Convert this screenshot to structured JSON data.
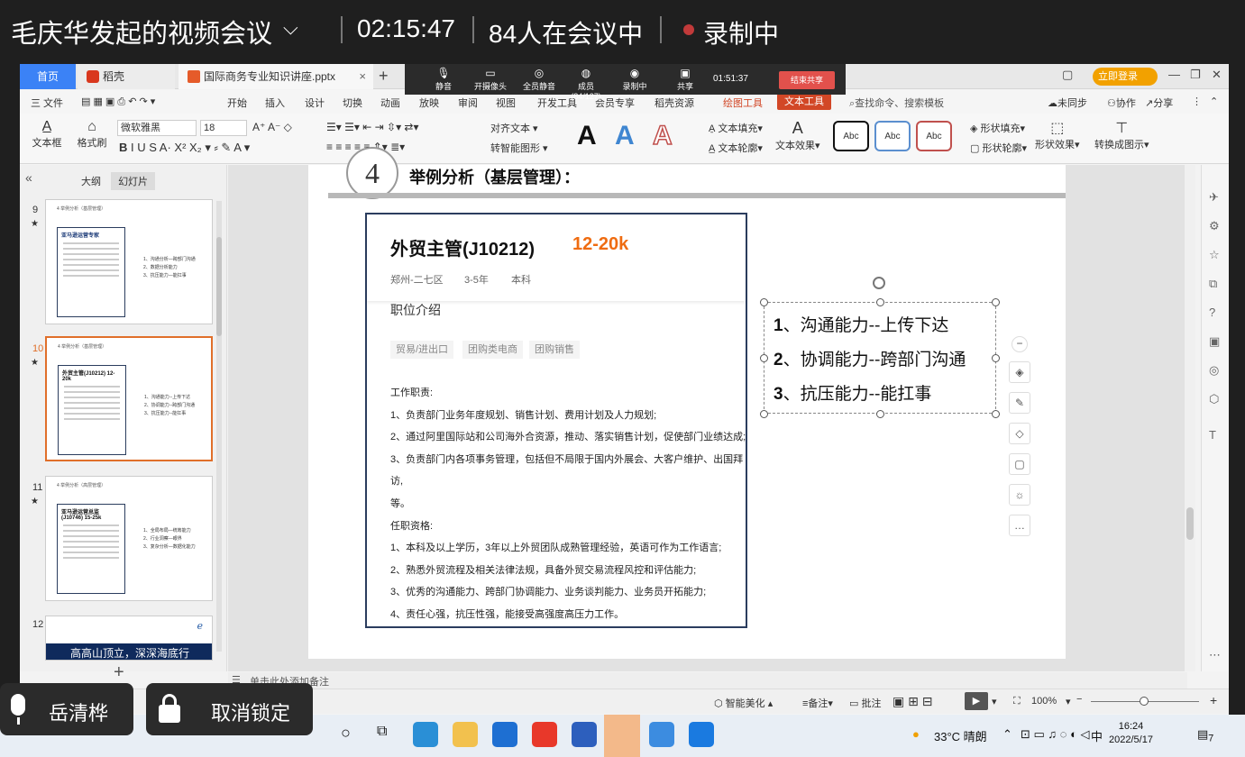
{
  "meeting": {
    "title": "毛庆华发起的视频会议",
    "timer": "02:15:47",
    "participants": "84人在会议中",
    "recording": "录制中"
  },
  "wps": {
    "tabs": {
      "home": "首页",
      "daoke": "稻壳",
      "file": "国际商务专业知识讲座.pptx",
      "close": "×",
      "plus": "+"
    },
    "login": "立即登录",
    "share_bar": {
      "items": [
        "静音",
        "开摄像头",
        "全员静音",
        "成员(84/127)",
        "录制中",
        "共享"
      ],
      "time": "01:51:37",
      "end": "结束共享"
    },
    "menu": {
      "file": "三 文件",
      "items": [
        "开始",
        "插入",
        "设计",
        "切换",
        "动画",
        "放映",
        "审阅",
        "视图",
        "开发工具",
        "会员专享",
        "稻壳资源"
      ],
      "draw_tool": "绘图工具",
      "text_tool": "文本工具",
      "search": "查找命令、搜索模板",
      "sync": "未同步",
      "collab": "协作",
      "share": "分享"
    },
    "ribbon": {
      "textbox": "文本框",
      "format_brush": "格式刷",
      "font": "微软雅黑",
      "size": "18",
      "align_text": "对齐文本",
      "smart_shape": "转智能图形",
      "text_fill": "文本填充",
      "text_outline": "文本轮廓",
      "text_effect": "文本效果",
      "abc": "Abc",
      "shape_fill": "形状填充",
      "shape_outline": "形状轮廓",
      "shape_effect": "形状效果",
      "convert": "转换成图示"
    },
    "panel": {
      "outline": "大纲",
      "slides": "幻灯片",
      "slide_nums": [
        "9",
        "10",
        "11",
        "12"
      ],
      "star": "★",
      "add": "+",
      "thumb12_text": "高高山顶立，深深海底行",
      "thumb9": {
        "header": "4 举例分析（基层管理）",
        "title": "亚马逊运营专家",
        "side": [
          "1、沟通分析—跨部门沟通",
          "2、数据分析能力",
          "3、抗压能力—能扛事"
        ]
      },
      "thumb10": {
        "header": "4 举例分析（基层管理）",
        "title": "外贸主管(J10212)  12-20k",
        "side": [
          "1、沟通能力--上传下达",
          "2、协调能力--跨部门沟通",
          "3、抗压能力--能扛事"
        ]
      },
      "thumb11": {
        "header": "4 举例分析（高层管理）",
        "title": "亚马逊运营总监(J10746)  15-25k",
        "side": [
          "1、全局布局—统筹能力",
          "2、行业洞察—眼界",
          "3、复杂分析—数据化能力"
        ]
      }
    },
    "slide": {
      "num": "4",
      "heading": "举例分析（基层管理）：",
      "job_title": "外贸主管(J10212)",
      "salary": "12-20k",
      "meta": [
        "郑州-二七区",
        "3-5年",
        "本科"
      ],
      "intro": "职位介绍",
      "tags": [
        "贸易/进出口",
        "团购类电商",
        "团购销售"
      ],
      "body": [
        "工作职责:",
        "1、负责部门业务年度规划、销售计划、费用计划及人力规划;",
        "2、通过阿里国际站和公司海外合资源，推动、落实销售计划，促使部门业绩达成;",
        "3、负责部门内各项事务管理，包括但不局限于国内外展会、大客户维护、出国拜访,",
        "等。",
        "任职资格:",
        "1、本科及以上学历，3年以上外贸团队成熟管理经验，英语可作为工作语言;",
        "2、熟悉外贸流程及相关法律法规，具备外贸交易流程风控和评估能力;",
        "3、优秀的沟通能力、跨部门协调能力、业务谈判能力、业务员开拓能力;",
        "4、责任心强，抗压性强，能接受高强度高压力工作。"
      ],
      "points": [
        {
          "num": "1",
          "text": "、沟通能力--上传下达"
        },
        {
          "num": "2",
          "text": "、协调能力--跨部门沟通"
        },
        {
          "num": "3",
          "text": "、抗压能力--能扛事"
        }
      ]
    },
    "notes": "单击此处添加备注",
    "status": {
      "smart": "智能美化",
      "notes": "备注",
      "comment": "批注",
      "zoom": "100%"
    }
  },
  "overlay": {
    "user": "岳清桦",
    "unlock": "取消锁定"
  },
  "taskbar": {
    "weather": "33°C 晴朗",
    "ime": "中",
    "time": "16:24",
    "date": "2022/5/17",
    "notif": "7"
  }
}
